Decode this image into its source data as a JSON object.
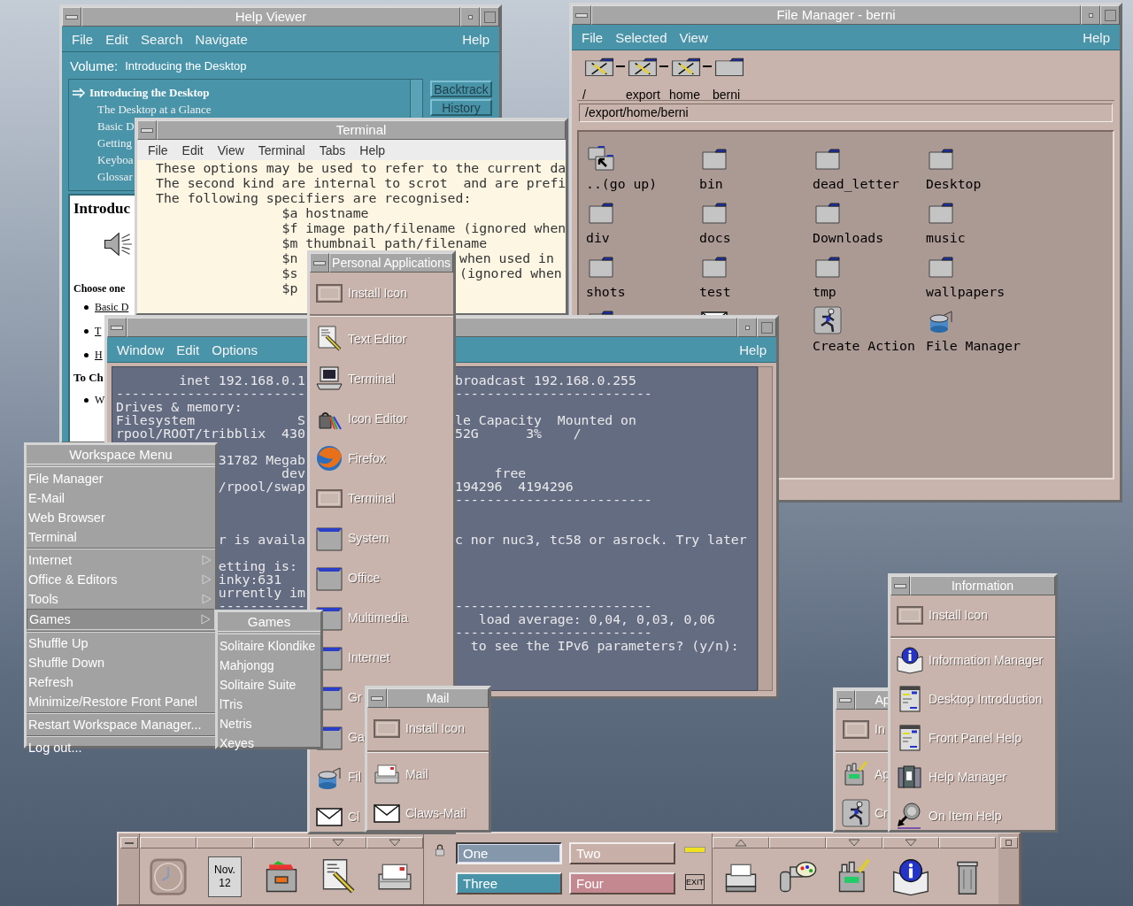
{
  "help_viewer": {
    "title": "Help Viewer",
    "menus": [
      "File",
      "Edit",
      "Search",
      "Navigate"
    ],
    "help_menu": "Help",
    "volume_label": "Volume:",
    "volume": "Introducing the Desktop",
    "topics": [
      {
        "label": "Introducing the Desktop",
        "selected": true,
        "children": [
          {
            "label": "The Desktop at a Glance",
            "selected": false
          },
          {
            "label": "Basic D",
            "selected": false
          },
          {
            "label": "Getting",
            "selected": false
          },
          {
            "label": "Keyboa",
            "selected": false
          },
          {
            "label": "Glossar",
            "selected": false
          }
        ]
      }
    ],
    "buttons": [
      "Backtrack",
      "History"
    ],
    "heading": "Introduc",
    "prompt": "Choose one",
    "body": [
      {
        "kind": "link",
        "text": "Basic D"
      },
      {
        "kind": "link",
        "text": "T"
      },
      {
        "kind": "link",
        "text": "H"
      },
      {
        "kind": "subheading",
        "text": "To Ch"
      },
      {
        "kind": "item",
        "text": "W"
      }
    ]
  },
  "terminal": {
    "title": "Terminal",
    "menus": [
      "File",
      "Edit",
      "View",
      "Terminal",
      "Tabs",
      "Help"
    ],
    "lines": [
      {
        "text": "These options may be used to refer to the current da"
      },
      {
        "text": "The second kind are internal to scrot  and are prefi"
      },
      {
        "text": "The following specifiers are recognised:"
      },
      {
        "spec": "$a hostname"
      },
      {
        "spec": "$f image path/filename (ignored when"
      },
      {
        "spec": "$m thumbnail path/filename"
      },
      {
        "spec": "$n",
        "tail": "when used in"
      },
      {
        "spec": "$s",
        "tail": "(ignored when"
      },
      {
        "spec": "$p"
      }
    ]
  },
  "file_manager": {
    "title": "File Manager - berni",
    "menus": [
      "File",
      "Selected",
      "View"
    ],
    "help_menu": "Help",
    "path_icons": [
      {
        "label": "/",
        "kind": "folder-tool"
      },
      {
        "label": "export",
        "kind": "folder-tool"
      },
      {
        "label": "home",
        "kind": "folder-tool"
      },
      {
        "label": "berni",
        "kind": "folder"
      }
    ],
    "path": "/export/home/berni",
    "items": [
      {
        "label": "..(go up)",
        "kind": "folder-up"
      },
      {
        "label": "bin",
        "kind": "folder"
      },
      {
        "label": "dead_letter",
        "kind": "folder"
      },
      {
        "label": "Desktop",
        "kind": "folder"
      },
      {
        "label": "div",
        "kind": "folder"
      },
      {
        "label": "docs",
        "kind": "folder"
      },
      {
        "label": "Downloads",
        "kind": "folder"
      },
      {
        "label": "music",
        "kind": "folder"
      },
      {
        "label": "shots",
        "kind": "folder"
      },
      {
        "label": "test",
        "kind": "folder"
      },
      {
        "label": "tmp",
        "kind": "folder"
      },
      {
        "label": "wallpapers",
        "kind": "folder"
      },
      {
        "kind": "folder"
      },
      {
        "kind": "envelope"
      },
      {
        "label": "Create Action",
        "kind": "runner"
      },
      {
        "label": "File Manager",
        "kind": "cylinder"
      }
    ]
  },
  "console": {
    "menus": [
      "Window",
      "Edit",
      "Options"
    ],
    "help_menu": "Help",
    "rows": [
      {
        "a": "        inet 192.168.0.1",
        "c": "broadcast 192.168.0.255"
      },
      {
        "a": "------------------------",
        "c": "-------------------------"
      },
      {
        "a": "Drives & memory:"
      },
      {
        "a": "Filesystem             S",
        "c": "le Capacity  Mounted on"
      },
      {
        "a": "rpool/ROOT/tribblix  430",
        "c": "52G      3%    /"
      },
      {},
      {
        "b": "31782 Megab"
      },
      {
        "b": "        dev",
        "c": "     free"
      },
      {
        "b": "/rpool/swap",
        "c": "194296  4194296"
      },
      {
        "c": "-------------------------"
      },
      {},
      {},
      {
        "b": "r is availa",
        "c": "c nor nuc3, tc58 or asrock. Try later"
      },
      {},
      {
        "b": "etting is:"
      },
      {
        "b": "inky:631"
      },
      {
        "b": "urrently im"
      },
      {
        "b": "-----------",
        "c": "-------------------------"
      },
      {
        "c": "   load average: 0,04, 0,03, 0,06"
      },
      {
        "c": "-------------------------"
      },
      {
        "c": "  to see the IPv6 parameters? (y/n):"
      }
    ]
  },
  "personal_applications": {
    "title": "Personal Applications",
    "install": "Install Icon",
    "items": [
      {
        "label": "Text Editor",
        "kind": "editor"
      },
      {
        "label": "Terminal",
        "kind": "terminal"
      },
      {
        "label": "Icon Editor",
        "kind": "painter"
      },
      {
        "label": "Firefox",
        "kind": "browser"
      },
      {
        "label": "Terminal",
        "kind": "install"
      },
      {
        "label": "System",
        "kind": "drawer"
      },
      {
        "label": "Office",
        "kind": "drawer"
      },
      {
        "label": "Multimedia",
        "kind": "drawer"
      },
      {
        "label": "Internet",
        "kind": "drawer"
      },
      {
        "label": "Gr",
        "kind": "drawer"
      },
      {
        "label": "Ga",
        "kind": "drawer"
      },
      {
        "label": "Fil",
        "kind": "cylinder"
      },
      {
        "label": "Cl",
        "kind": "envelope"
      }
    ]
  },
  "workspace_menu": {
    "title": "Workspace Menu",
    "groups": [
      [
        {
          "label": "File Manager",
          "submenu": false,
          "selected": false
        },
        {
          "label": "E-Mail",
          "submenu": false,
          "selected": false
        },
        {
          "label": "Web Browser",
          "submenu": false,
          "selected": false
        },
        {
          "label": "Terminal",
          "submenu": false,
          "selected": false
        }
      ],
      [
        {
          "label": "Internet",
          "submenu": true,
          "selected": false
        },
        {
          "label": "Office & Editors",
          "submenu": true,
          "selected": false
        },
        {
          "label": "Tools",
          "submenu": true,
          "selected": false
        },
        {
          "label": "Games",
          "submenu": true,
          "selected": true
        }
      ],
      [
        {
          "label": "Shuffle Up",
          "submenu": false,
          "selected": false
        },
        {
          "label": "Shuffle Down",
          "submenu": false,
          "selected": false
        },
        {
          "label": "Refresh",
          "submenu": false,
          "selected": false
        },
        {
          "label": "Minimize/Restore Front Panel",
          "submenu": false,
          "selected": false
        }
      ],
      [
        {
          "label": "Restart Workspace Manager...",
          "submenu": false,
          "selected": false
        }
      ],
      [
        {
          "label": "Log out...",
          "submenu": false,
          "selected": false
        }
      ]
    ]
  },
  "games_menu": {
    "title": "Games",
    "items": [
      "Solitaire Klondike",
      "Mahjongg",
      "Solitaire Suite",
      "lTris",
      "Netris",
      "Xeyes"
    ]
  },
  "mail_panel": {
    "title": "Mail",
    "install": "Install Icon",
    "items": [
      {
        "label": "Mail",
        "kind": "mailtray"
      },
      {
        "label": "Claws-Mail",
        "kind": "envelope"
      }
    ]
  },
  "app_panel": {
    "title": "Ap",
    "install": "In",
    "items": [
      {
        "label": "Ap",
        "kind": "appbox"
      },
      {
        "label": "Cr",
        "kind": "runner"
      }
    ]
  },
  "information_panel": {
    "title": "Information",
    "install": "Install Icon",
    "items": [
      {
        "label": "Information Manager",
        "kind": "info"
      },
      {
        "label": "Desktop Introduction",
        "kind": "screen"
      },
      {
        "label": "Front Panel Help",
        "kind": "screen"
      },
      {
        "label": "Help Manager",
        "kind": "books"
      },
      {
        "label": "On Item Help",
        "kind": "question"
      }
    ]
  },
  "front_panel": {
    "left": [
      {
        "kind": "clock",
        "subpanel": false
      },
      {
        "kind": "calendar",
        "subpanel": false,
        "month": "Nov.",
        "day": "12"
      },
      {
        "kind": "filebox",
        "subpanel": false
      },
      {
        "kind": "editor",
        "subpanel": true,
        "expanded": false
      },
      {
        "kind": "mailtray",
        "subpanel": true,
        "expanded": false
      }
    ],
    "workspaces": [
      {
        "label": "One",
        "color": "#8497ab",
        "selected": true
      },
      {
        "label": "Two",
        "color": "#c8b0a8",
        "selected": false
      },
      {
        "label": "Three",
        "color": "#4893a8",
        "selected": false
      },
      {
        "label": "Four",
        "color": "#c48890",
        "selected": false
      }
    ],
    "exit": "EXIT",
    "right": [
      {
        "kind": "printer",
        "subpanel": true,
        "expanded": true
      },
      {
        "kind": "palette",
        "subpanel": false
      },
      {
        "kind": "appbox",
        "subpanel": true,
        "expanded": false
      },
      {
        "kind": "info",
        "subpanel": true,
        "expanded": false
      },
      {
        "kind": "trash",
        "subpanel": false
      }
    ]
  }
}
